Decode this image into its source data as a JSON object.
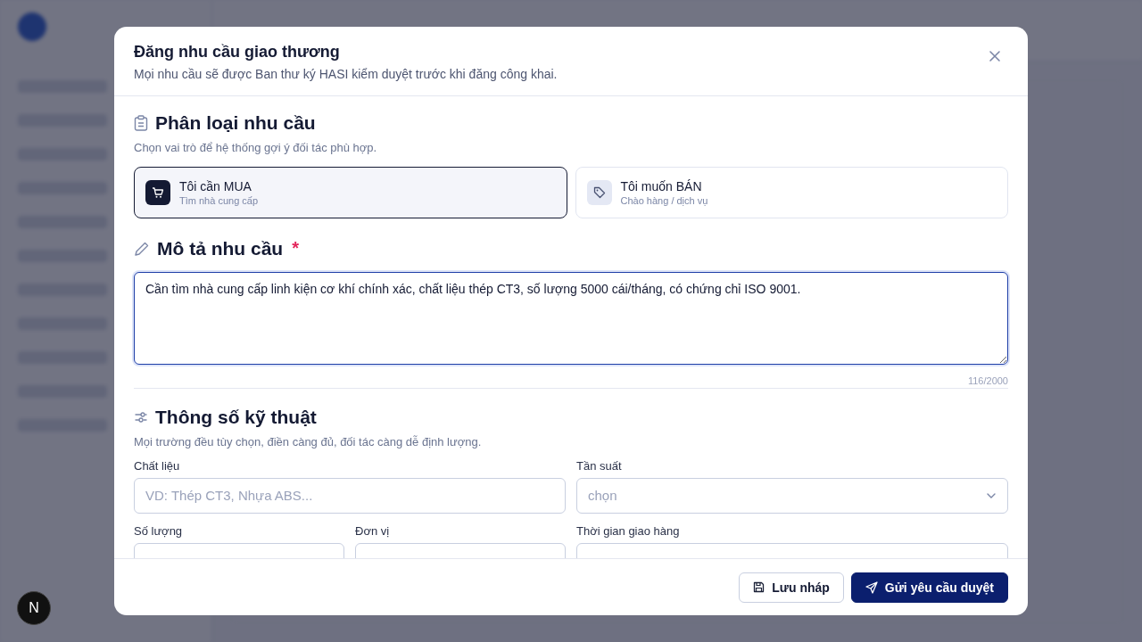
{
  "dialog": {
    "title": "Đăng nhu cầu giao thương",
    "subtitle": "Mọi nhu cầu sẽ được Ban thư ký HASI kiểm duyệt trước khi đăng công khai."
  },
  "classification": {
    "heading": "Phân loại nhu cầu",
    "hint": "Chọn vai trò để hệ thống gợi ý đối tác phù hợp.",
    "options": [
      {
        "kind": "buy",
        "label": "Tôi cần MUA",
        "sub": "Tìm nhà cung cấp",
        "selected": true
      },
      {
        "kind": "sell",
        "label": "Tôi muốn BÁN",
        "sub": "Chào hàng / dịch vụ",
        "selected": false
      }
    ]
  },
  "description": {
    "heading": "Mô tả nhu cầu",
    "required_mark": "*",
    "value": "Cần tìm nhà cung cấp linh kiện cơ khí chính xác, chất liệu thép CT3, số lượng 5000 cái/tháng, có chứng chỉ ISO 9001.",
    "counter": "116/2000"
  },
  "specs": {
    "heading": "Thông số kỹ thuật",
    "hint": "Mọi trường đều tùy chọn, điền càng đủ, đối tác càng dễ định lượng.",
    "fields": [
      {
        "kind": "text",
        "label": "Chất liệu",
        "placeholder": "VD: Thép CT3, Nhựa ABS..."
      },
      {
        "kind": "select",
        "label": "Tần suất",
        "placeholder": "chọn"
      },
      {
        "kind": "text",
        "label": "Số lượng"
      },
      {
        "kind": "text",
        "label": "Đơn vị"
      },
      {
        "kind": "text",
        "label": "Thời gian giao hàng"
      }
    ]
  },
  "buttons": [
    {
      "kind": "secondary",
      "label": "Lưu nháp"
    },
    {
      "kind": "primary",
      "label": "Gửi yêu cầu duyệt"
    }
  ],
  "dev_badge": {
    "label": "N"
  }
}
